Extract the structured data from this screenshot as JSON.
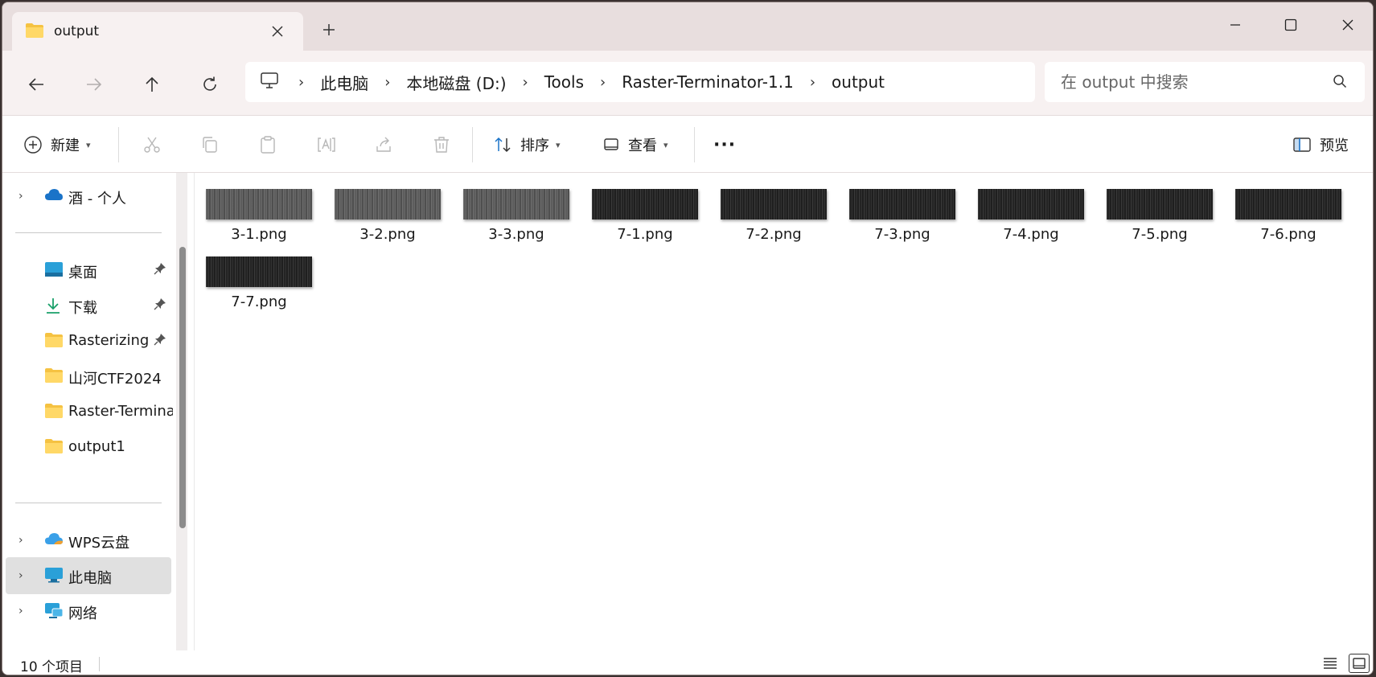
{
  "tab": {
    "title": "output"
  },
  "address": {
    "crumbs": [
      "此电脑",
      "本地磁盘 (D:)",
      "Tools",
      "Raster-Terminator-1.1",
      "output"
    ]
  },
  "search": {
    "placeholder": "在 output 中搜索"
  },
  "commands": {
    "new_label": "新建",
    "sort_label": "排序",
    "view_label": "查看",
    "more_label": "···",
    "preview_label": "预览"
  },
  "sidebar": {
    "items": [
      {
        "label": "酒 - 个人",
        "icon": "onedrive-cloud-icon"
      },
      {
        "label": "桌面",
        "icon": "desktop-icon"
      },
      {
        "label": "下载",
        "icon": "download-icon"
      },
      {
        "label": "Rasterizing T",
        "icon": "folder-icon"
      },
      {
        "label": "山河CTF2024",
        "icon": "folder-icon"
      },
      {
        "label": "Raster-Termina",
        "icon": "folder-icon"
      },
      {
        "label": "output1",
        "icon": "folder-icon"
      },
      {
        "label": "WPS云盘",
        "icon": "wps-cloud-icon"
      },
      {
        "label": "此电脑",
        "icon": "computer-icon"
      },
      {
        "label": "网络",
        "icon": "network-icon"
      }
    ]
  },
  "files": [
    {
      "name": "3-1.png",
      "tone": "gray"
    },
    {
      "name": "3-2.png",
      "tone": "gray"
    },
    {
      "name": "3-3.png",
      "tone": "gray"
    },
    {
      "name": "7-1.png",
      "tone": "dark"
    },
    {
      "name": "7-2.png",
      "tone": "dark"
    },
    {
      "name": "7-3.png",
      "tone": "dark"
    },
    {
      "name": "7-4.png",
      "tone": "dark"
    },
    {
      "name": "7-5.png",
      "tone": "dark"
    },
    {
      "name": "7-6.png",
      "tone": "dark"
    },
    {
      "name": "7-7.png",
      "tone": "dark"
    }
  ],
  "status": {
    "item_count": "10 个项目"
  },
  "colors": {
    "titlebar": "#e8dede",
    "accent_blue": "#1a73c8",
    "folder_yellow": "#f5c242"
  }
}
